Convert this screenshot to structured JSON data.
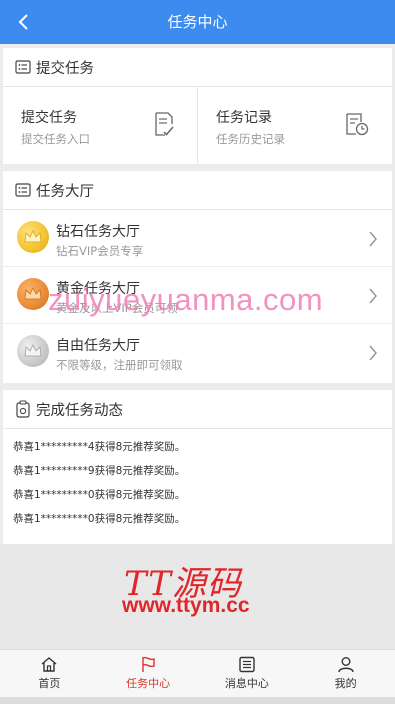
{
  "header": {
    "title": "任务中心"
  },
  "submit_section": {
    "title": "提交任务",
    "items": [
      {
        "title": "提交任务",
        "subtitle": "提交任务入口"
      },
      {
        "title": "任务记录",
        "subtitle": "任务历史记录"
      }
    ]
  },
  "hall_section": {
    "title": "任务大厅",
    "items": [
      {
        "title": "钻石任务大厅",
        "subtitle": "钻石VIP会员专享",
        "medal_color": "#f2c230"
      },
      {
        "title": "黄金任务大厅",
        "subtitle": "黄金及以上VIP会员可领",
        "medal_color": "#e98a33"
      },
      {
        "title": "自由任务大厅",
        "subtitle": "不限等级，注册即可领取",
        "medal_color": "#c9c9c9"
      }
    ]
  },
  "dynamics_section": {
    "title": "完成任务动态",
    "entries": [
      "恭喜1*********4获得8元推荐奖励。",
      "恭喜1*********9获得8元推荐奖励。",
      "恭喜1*********0获得8元推荐奖励。",
      "恭喜1*********0获得8元推荐奖励。"
    ]
  },
  "watermark": {
    "overlay_text": "zuiyueyuanma.com",
    "logo_text": "TT源码",
    "url_text": "www.ttym.cc"
  },
  "tabbar": {
    "items": [
      {
        "label": "首页",
        "icon": "home-icon"
      },
      {
        "label": "任务中心",
        "icon": "flag-icon",
        "active": true
      },
      {
        "label": "消息中心",
        "icon": "message-icon"
      },
      {
        "label": "我的",
        "icon": "user-icon"
      }
    ]
  },
  "colors": {
    "primary": "#3d8bef",
    "active_tab": "#e2322a",
    "watermark_red": "#e0262a"
  }
}
